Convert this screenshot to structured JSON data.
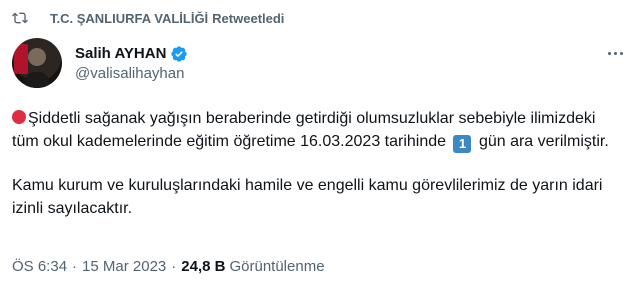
{
  "retweet": {
    "icon": "retweet-icon",
    "account": "T.C. ŞANLIURFA VALİLİĞİ",
    "label": "Retweetledi"
  },
  "author": {
    "name": "Salih AYHAN",
    "handle": "@valisalihayhan",
    "verified_icon": "verified-badge-icon",
    "verified_color": "#1d9bf0"
  },
  "more_icon": "more-options-icon",
  "tweet": {
    "lead_emoji": "red-circle-icon",
    "line1": "Şiddetli sağanak yağışın beraberinde getirdiği olumsuzluklar sebebiyle ilimizdeki tüm okul kademelerinde eğitim öğretime 16.03.2023 tarihinde",
    "keycap": "1",
    "line1_end": "gün ara verilmiştir.",
    "line2": "Kamu kurum ve kuruluşlarındaki hamile ve engelli kamu görevlilerimiz de yarın idari izinli sayılacaktır."
  },
  "meta": {
    "time": "ÖS 6:34",
    "dot": "·",
    "date": "15 Mar 2023",
    "views_count": "24,8 B",
    "views_label": "Görüntülenme"
  },
  "colors": {
    "text_primary": "#0f1419",
    "text_secondary": "#536471",
    "red_circle": "#dd2e44",
    "keycap": "#3b88c3"
  }
}
